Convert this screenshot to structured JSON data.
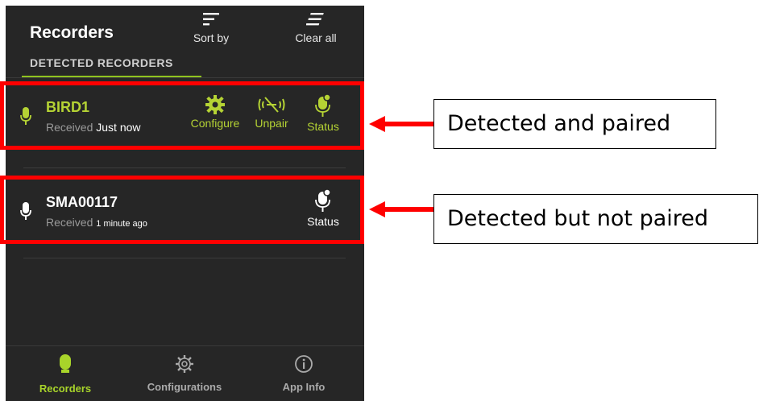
{
  "header": {
    "title": "Recorders",
    "sort_label": "Sort by",
    "clear_label": "Clear all",
    "section_title": "DETECTED RECORDERS"
  },
  "recorders": [
    {
      "name": "BIRD1",
      "received_label": "Received",
      "received_value": "Just now",
      "paired": true,
      "actions": [
        "Configure",
        "Unpair",
        "Status"
      ]
    },
    {
      "name": "SMA00117",
      "received_label": "Received",
      "received_value": "1 minute ago",
      "paired": false,
      "actions": [
        "Status"
      ]
    }
  ],
  "bottom_nav": [
    {
      "label": "Recorders",
      "icon": "microphone-icon",
      "active": true
    },
    {
      "label": "Configurations",
      "icon": "gear-icon",
      "active": false
    },
    {
      "label": "App Info",
      "icon": "info-icon",
      "active": false
    }
  ],
  "annotations": {
    "paired_label": "Detected and paired",
    "not_paired_label": "Detected but not paired"
  },
  "colors": {
    "accent_green": "#b5d334",
    "background": "#262626",
    "highlight_red": "#ff0000"
  }
}
